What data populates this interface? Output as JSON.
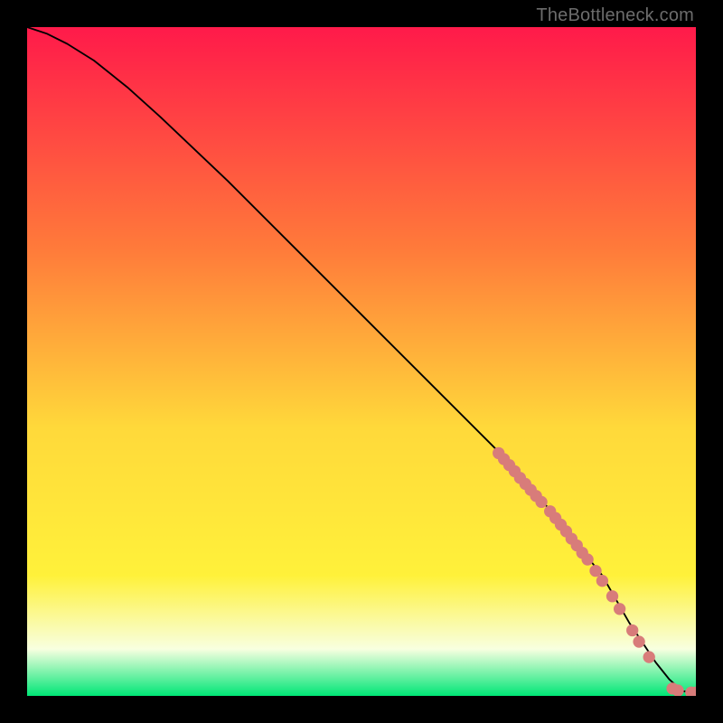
{
  "watermark": "TheBottleneck.com",
  "colors": {
    "top": "#ff1a4a",
    "mid1": "#ff7a3a",
    "mid2": "#ffd93a",
    "mid3": "#fff13a",
    "pale": "#f8ffe0",
    "bottom": "#00e676",
    "curve": "#000000",
    "dot": "#d87c7a"
  },
  "chart_data": {
    "type": "line",
    "title": "",
    "xlabel": "",
    "ylabel": "",
    "xlim": [
      0,
      100
    ],
    "ylim": [
      0,
      100
    ],
    "series": [
      {
        "name": "curve",
        "x": [
          0,
          3,
          6,
          10,
          15,
          20,
          30,
          40,
          50,
          60,
          70,
          78,
          82,
          86,
          90,
          92,
          94,
          96,
          98,
          100
        ],
        "y": [
          100,
          99,
          97.5,
          95,
          91,
          86.5,
          77,
          67,
          57,
          47,
          37,
          28,
          23,
          18,
          11,
          8,
          5,
          2.5,
          0.7,
          0.5
        ]
      }
    ],
    "dots": {
      "name": "markers",
      "points": [
        {
          "x": 70.5,
          "y": 36.3
        },
        {
          "x": 71.3,
          "y": 35.4
        },
        {
          "x": 72.1,
          "y": 34.5
        },
        {
          "x": 72.9,
          "y": 33.6
        },
        {
          "x": 73.7,
          "y": 32.6
        },
        {
          "x": 74.5,
          "y": 31.7
        },
        {
          "x": 75.3,
          "y": 30.8
        },
        {
          "x": 76.1,
          "y": 29.9
        },
        {
          "x": 76.9,
          "y": 29.0
        },
        {
          "x": 78.2,
          "y": 27.6
        },
        {
          "x": 79.0,
          "y": 26.6
        },
        {
          "x": 79.8,
          "y": 25.6
        },
        {
          "x": 80.6,
          "y": 24.6
        },
        {
          "x": 81.4,
          "y": 23.5
        },
        {
          "x": 82.2,
          "y": 22.5
        },
        {
          "x": 83.0,
          "y": 21.4
        },
        {
          "x": 83.8,
          "y": 20.4
        },
        {
          "x": 85.0,
          "y": 18.7
        },
        {
          "x": 86.0,
          "y": 17.2
        },
        {
          "x": 87.5,
          "y": 14.9
        },
        {
          "x": 88.6,
          "y": 13.0
        },
        {
          "x": 90.5,
          "y": 9.8
        },
        {
          "x": 91.5,
          "y": 8.1
        },
        {
          "x": 93.0,
          "y": 5.8
        },
        {
          "x": 96.5,
          "y": 1.1
        },
        {
          "x": 97.3,
          "y": 0.8
        },
        {
          "x": 99.3,
          "y": 0.5
        },
        {
          "x": 100.0,
          "y": 0.5
        }
      ]
    },
    "gradient_stops": [
      {
        "pos": 0.0,
        "key": "top"
      },
      {
        "pos": 0.33,
        "key": "mid1"
      },
      {
        "pos": 0.6,
        "key": "mid2"
      },
      {
        "pos": 0.82,
        "key": "mid3"
      },
      {
        "pos": 0.93,
        "key": "pale"
      },
      {
        "pos": 1.0,
        "key": "bottom"
      }
    ]
  }
}
